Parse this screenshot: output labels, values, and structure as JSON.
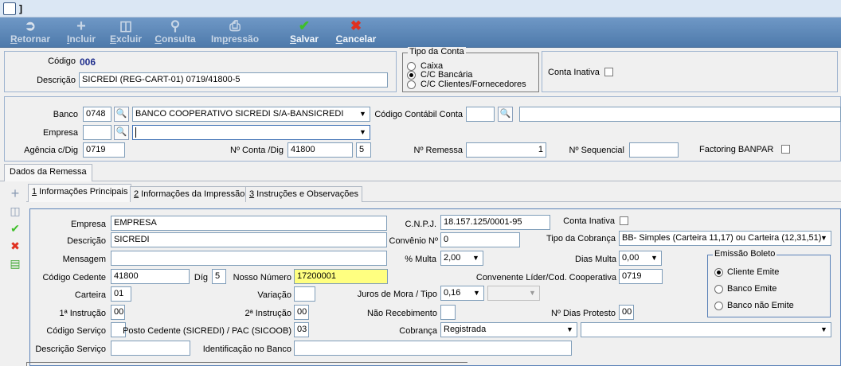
{
  "window": {
    "title": "]"
  },
  "toolbar": {
    "retornar": {
      "pre": "",
      "u": "R",
      "post": "etornar"
    },
    "incluir": {
      "pre": "",
      "u": "I",
      "post": "ncluir"
    },
    "excluir": {
      "pre": "",
      "u": "E",
      "post": "xcluir"
    },
    "consulta": {
      "pre": "",
      "u": "C",
      "post": "onsulta"
    },
    "impressao": {
      "pre": "Im",
      "u": "p",
      "post": "ressão"
    },
    "salvar": {
      "pre": "",
      "u": "S",
      "post": "alvar"
    },
    "cancelar": {
      "pre": "",
      "u": "C",
      "post": "ancelar"
    }
  },
  "header": {
    "codigo_label": "Código",
    "codigo_value": "006",
    "descricao_label": "Descrição",
    "descricao_value": "SICREDI (REG-CART-01) 0719/41800-5"
  },
  "tipo_conta": {
    "title": "Tipo da Conta",
    "options": [
      "Caixa",
      "C/C Bancária",
      "C/C Clientes/Fornecedores"
    ],
    "selected": "C/C Bancária"
  },
  "conta_inativa": {
    "label": "Conta Inativa",
    "checked": false
  },
  "bank": {
    "banco_label": "Banco",
    "banco_code": "0748",
    "banco_name": "BANCO COOPERATIVO SICREDI S/A-BANSICREDI",
    "codigo_contabil_label": "Código Contábil Conta",
    "codigo_contabil_value": "",
    "codigo_contabil_desc": "",
    "empresa_label": "Empresa",
    "empresa_code": "",
    "empresa_name": "",
    "agencia_label": "Agência c/Dig",
    "agencia_value": "0719",
    "conta_label": "Nº Conta /Dig",
    "conta_value": "41800",
    "conta_dig": "5",
    "remessa_label": "Nº Remessa",
    "remessa_value": "1",
    "sequencial_label": "Nº Sequencial",
    "sequencial_value": "",
    "factoring_label": "Factoring BANPAR"
  },
  "outer_tab": {
    "label": "Dados da Remessa"
  },
  "inner_tabs": [
    {
      "u": "1",
      "label": " Informações Principais"
    },
    {
      "u": "2",
      "label": " Informações da Impressão"
    },
    {
      "u": "3",
      "label": " Instruções e Observações"
    }
  ],
  "form": {
    "empresa_label": "Empresa",
    "empresa_value": "EMPRESA",
    "cnpj_label": "C.N.P.J.",
    "cnpj_value": "18.157.125/0001-95",
    "conta_inativa_label": "Conta Inativa",
    "descricao_label": "Descrição",
    "descricao_value": "SICREDI",
    "convenio_label": "Convênio Nº",
    "convenio_value": "0",
    "tipo_cobranca_label": "Tipo da Cobrança",
    "tipo_cobranca_value": "BB- Simples (Carteira 11,17) ou Carteira (12,31,51)",
    "mensagem_label": "Mensagem",
    "mensagem_value": "",
    "multa_label": "% Multa",
    "multa_value": "2,00",
    "dias_multa_label": "Dias Multa",
    "dias_multa_value": "0,00",
    "cedente_label": "Código Cedente",
    "cedente_value": "41800",
    "dig_label": "Díg",
    "dig_value": "5",
    "nosso_numero_label": "Nosso Número",
    "nosso_numero_value": "17200001",
    "convenente_label": "Convenente Líder/Cod. Cooperativa",
    "convenente_value": "0719",
    "carteira_label": "Carteira",
    "carteira_value": "01",
    "variacao_label": "Variação",
    "variacao_value": "",
    "juros_label": "Juros de Mora / Tipo",
    "juros_value": "0,16",
    "juros_tipo": "",
    "instrucao1_label": "1ª Instrução",
    "instrucao1_value": "00",
    "instrucao2_label": "2ª Instrução",
    "instrucao2_value": "00",
    "nao_recebimento_label": "Não Recebimento",
    "nao_recebimento_value": "",
    "dias_protesto_label": "Nº Dias Protesto",
    "dias_protesto_value": "00",
    "codigo_servico_label": "Código Serviço",
    "codigo_servico_value": "",
    "posto_label": "Posto Cedente (SICREDI) / PAC  (SICOOB)",
    "posto_value": "03",
    "cobranca_label": "Cobrança",
    "cobranca_value": "Registrada",
    "cobranca_extra": "",
    "descricao_servico_label": "Descrição Serviço",
    "descricao_servico_value": "",
    "identificacao_label": "Identificação no Banco",
    "identificacao_value": ""
  },
  "emissao": {
    "title": "Emissão Boleto",
    "options": [
      "Cliente Emite",
      "Banco Emite",
      "Banco não Emite"
    ],
    "selected": "Cliente Emite"
  },
  "colors": {
    "toolbar_start": "#6f98c6",
    "toolbar_end": "#4e7aab",
    "highlight": "#ffff80",
    "border": "#9db3cf"
  }
}
